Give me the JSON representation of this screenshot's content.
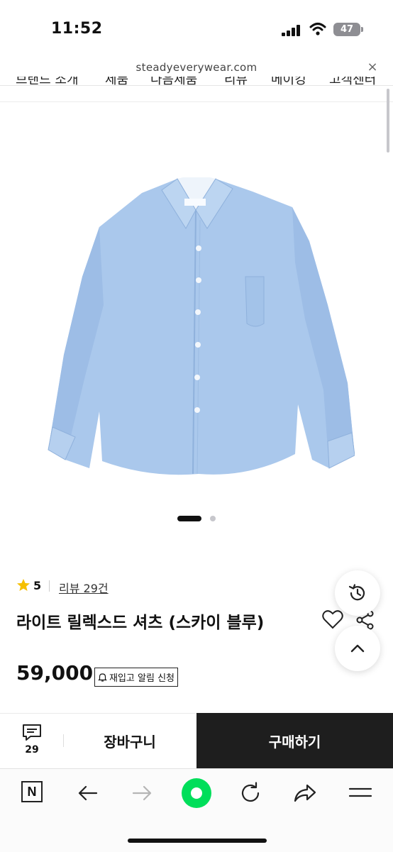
{
  "status_bar": {
    "time": "11:52",
    "battery": "47"
  },
  "browser": {
    "url": "steadyeverywear.com",
    "close_glyph": "×"
  },
  "clipped_nav": [
    "브랜드 소개",
    "제품",
    "다음제품",
    "리뷰",
    "메이킹",
    "고객센터"
  ],
  "product": {
    "rating": "5",
    "review_link": "리뷰 29건",
    "title": "라이트 릴렉스드 셔츠 (스카이 블루)",
    "price": "59,000",
    "restock_label": "재입고 알림 신청",
    "carousel_total": 2,
    "carousel_index": 1
  },
  "bottom_bar": {
    "chat_count": "29",
    "cart_label": "장바구니",
    "buy_label": "구매하기"
  },
  "toolbar": {
    "naver_logo": "N"
  },
  "colors": {
    "buy_bg": "#1e1e1e",
    "naver_green": "#00de5a",
    "star": "#f6c000",
    "shirt": "#aac8ec"
  },
  "icons": {
    "recent": "history-icon",
    "top": "chevron-up-icon",
    "heart": "heart-icon",
    "share": "share-icon",
    "chat": "chat-icon",
    "bell": "bell-icon"
  }
}
